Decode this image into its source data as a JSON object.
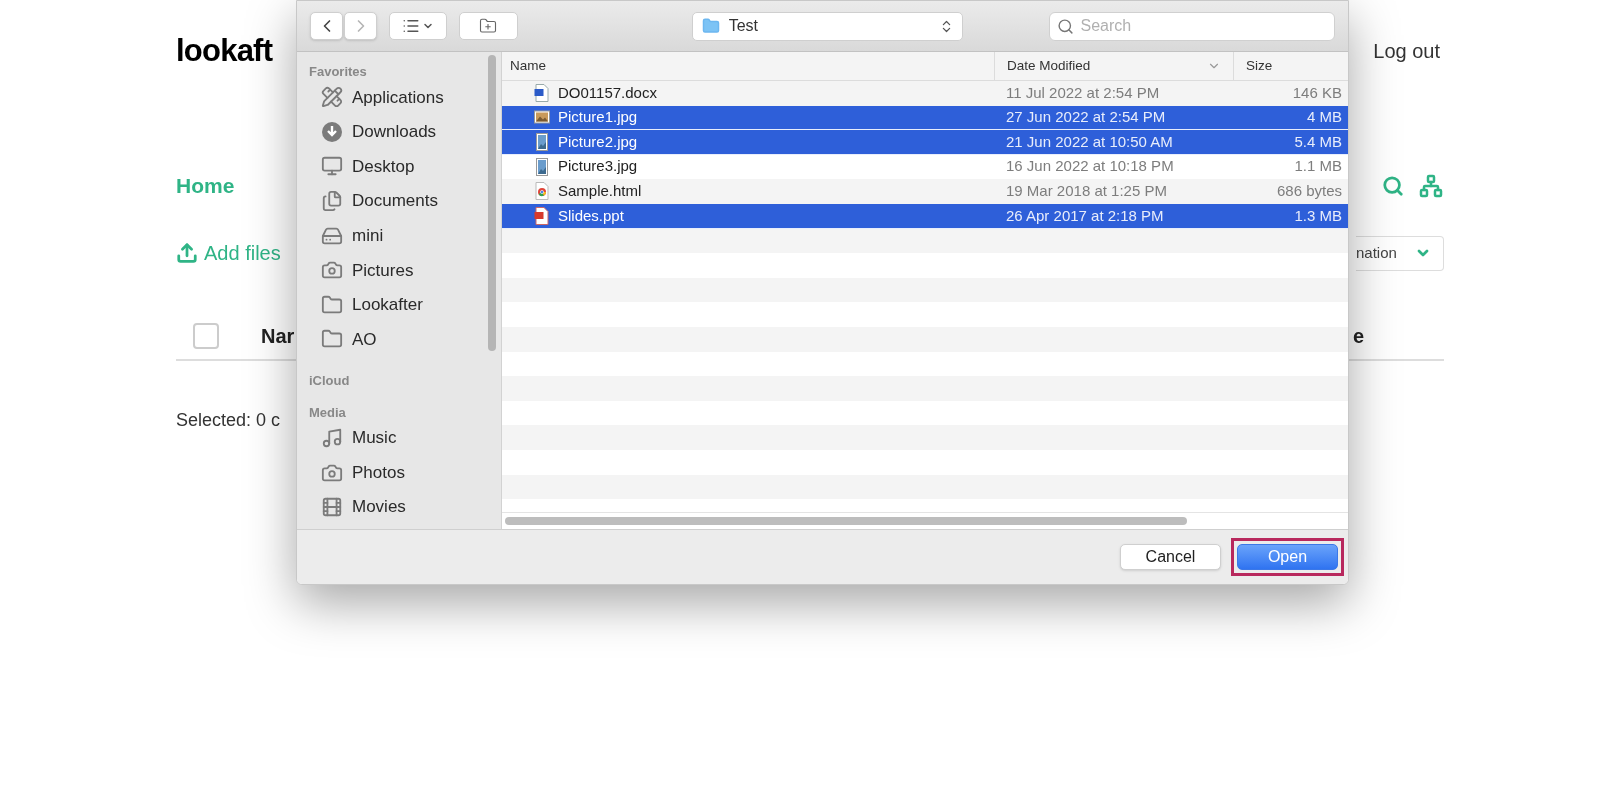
{
  "page": {
    "logo": "lookaft",
    "logout": "Log out",
    "breadcrumb": "Home",
    "add_files": "Add files",
    "dropdown": "nation",
    "table_header": {
      "checked": false,
      "column_1": "Nar",
      "column_2": "e"
    },
    "selected_status": "Selected: 0 c"
  },
  "dialog": {
    "toolbar": {
      "nav": [
        {
          "kind": "back",
          "disabled": false
        },
        {
          "kind": "forward",
          "disabled": true
        }
      ],
      "location": "Test",
      "search_placeholder": "Search"
    },
    "sidebar": [
      {
        "heading": "Favorites",
        "items": [
          {
            "label": "Applications",
            "kind": "applications"
          },
          {
            "label": "Downloads",
            "kind": "downloads"
          },
          {
            "label": "Desktop",
            "kind": "desktop"
          },
          {
            "label": "Documents",
            "kind": "documents"
          },
          {
            "label": "mini",
            "kind": "disk"
          },
          {
            "label": "Pictures",
            "kind": "camera"
          },
          {
            "label": "Lookafter",
            "kind": "folder"
          },
          {
            "label": "AO",
            "kind": "folder"
          }
        ]
      },
      {
        "heading": "iCloud"
      },
      {
        "heading": "Media",
        "items": [
          {
            "label": "Music",
            "kind": "music"
          },
          {
            "label": "Photos",
            "kind": "camera"
          },
          {
            "label": "Movies",
            "kind": "film"
          }
        ]
      }
    ],
    "columns": [
      {
        "label": "Name",
        "sorted": false
      },
      {
        "label": "Date Modified",
        "sorted": true
      },
      {
        "label": "Size",
        "sorted": false
      }
    ],
    "files": [
      {
        "name": "DO01157.docx",
        "date": "11 Jul 2022 at 2:54 PM",
        "size": "146 KB",
        "kind": "document",
        "selected": false
      },
      {
        "name": "Picture1.jpg",
        "date": "27 Jun 2022 at 2:54 PM",
        "size": "4 MB",
        "kind": "image",
        "selected": true
      },
      {
        "name": "Picture2.jpg",
        "date": "21 Jun 2022 at 10:50 AM",
        "size": "5.4 MB",
        "kind": "portrait",
        "selected": true
      },
      {
        "name": "Picture3.jpg",
        "date": "16 Jun 2022 at 10:18 PM",
        "size": "1.1 MB",
        "kind": "portrait",
        "selected": false
      },
      {
        "name": "Sample.html",
        "date": "19 Mar 2018 at 1:25 PM",
        "size": "686 bytes",
        "kind": "web",
        "selected": false
      },
      {
        "name": "Slides.ppt",
        "date": "26 Apr 2017 at 2:18 PM",
        "size": "1.3 MB",
        "kind": "slides",
        "selected": true
      }
    ],
    "buttons": [
      {
        "label": "Cancel",
        "default": false,
        "highlighted": false
      },
      {
        "label": "Open",
        "default": true,
        "highlighted": true
      }
    ]
  }
}
